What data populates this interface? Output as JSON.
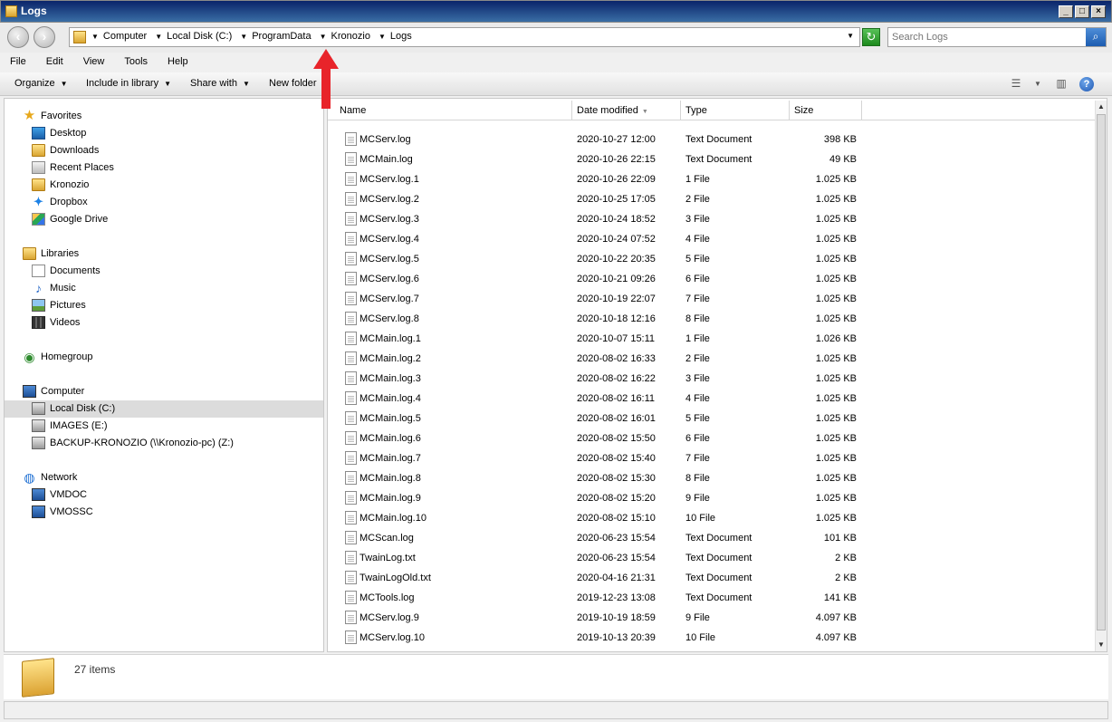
{
  "window": {
    "title": "Logs"
  },
  "address": {
    "crumbs": [
      "Computer",
      "Local Disk (C:)",
      "ProgramData",
      "Kronozio",
      "Logs"
    ]
  },
  "search": {
    "placeholder": "Search Logs"
  },
  "menu": [
    "File",
    "Edit",
    "View",
    "Tools",
    "Help"
  ],
  "toolbar": {
    "organize": "Organize",
    "include": "Include in library",
    "share": "Share with",
    "new_folder": "New folder"
  },
  "nav": {
    "favorites": "Favorites",
    "favorites_items": [
      "Desktop",
      "Downloads",
      "Recent Places",
      "Kronozio",
      "Dropbox",
      "Google Drive"
    ],
    "libraries": "Libraries",
    "libraries_items": [
      "Documents",
      "Music",
      "Pictures",
      "Videos"
    ],
    "homegroup": "Homegroup",
    "computer": "Computer",
    "computer_items": [
      "Local Disk (C:)",
      "IMAGES (E:)",
      "BACKUP-KRONOZIO (\\\\Kronozio-pc) (Z:)"
    ],
    "network": "Network",
    "network_items": [
      "VMDOC",
      "VMOSSC"
    ]
  },
  "columns": {
    "name": "Name",
    "date": "Date modified",
    "type": "Type",
    "size": "Size"
  },
  "files": [
    {
      "name": "MCServ.log",
      "date": "2020-10-27 12:00",
      "type": "Text Document",
      "size": "398 KB"
    },
    {
      "name": "MCMain.log",
      "date": "2020-10-26 22:15",
      "type": "Text Document",
      "size": "49 KB"
    },
    {
      "name": "MCServ.log.1",
      "date": "2020-10-26 22:09",
      "type": "1 File",
      "size": "1.025 KB"
    },
    {
      "name": "MCServ.log.2",
      "date": "2020-10-25 17:05",
      "type": "2 File",
      "size": "1.025 KB"
    },
    {
      "name": "MCServ.log.3",
      "date": "2020-10-24 18:52",
      "type": "3 File",
      "size": "1.025 KB"
    },
    {
      "name": "MCServ.log.4",
      "date": "2020-10-24 07:52",
      "type": "4 File",
      "size": "1.025 KB"
    },
    {
      "name": "MCServ.log.5",
      "date": "2020-10-22 20:35",
      "type": "5 File",
      "size": "1.025 KB"
    },
    {
      "name": "MCServ.log.6",
      "date": "2020-10-21 09:26",
      "type": "6 File",
      "size": "1.025 KB"
    },
    {
      "name": "MCServ.log.7",
      "date": "2020-10-19 22:07",
      "type": "7 File",
      "size": "1.025 KB"
    },
    {
      "name": "MCServ.log.8",
      "date": "2020-10-18 12:16",
      "type": "8 File",
      "size": "1.025 KB"
    },
    {
      "name": "MCMain.log.1",
      "date": "2020-10-07 15:11",
      "type": "1 File",
      "size": "1.026 KB"
    },
    {
      "name": "MCMain.log.2",
      "date": "2020-08-02 16:33",
      "type": "2 File",
      "size": "1.025 KB"
    },
    {
      "name": "MCMain.log.3",
      "date": "2020-08-02 16:22",
      "type": "3 File",
      "size": "1.025 KB"
    },
    {
      "name": "MCMain.log.4",
      "date": "2020-08-02 16:11",
      "type": "4 File",
      "size": "1.025 KB"
    },
    {
      "name": "MCMain.log.5",
      "date": "2020-08-02 16:01",
      "type": "5 File",
      "size": "1.025 KB"
    },
    {
      "name": "MCMain.log.6",
      "date": "2020-08-02 15:50",
      "type": "6 File",
      "size": "1.025 KB"
    },
    {
      "name": "MCMain.log.7",
      "date": "2020-08-02 15:40",
      "type": "7 File",
      "size": "1.025 KB"
    },
    {
      "name": "MCMain.log.8",
      "date": "2020-08-02 15:30",
      "type": "8 File",
      "size": "1.025 KB"
    },
    {
      "name": "MCMain.log.9",
      "date": "2020-08-02 15:20",
      "type": "9 File",
      "size": "1.025 KB"
    },
    {
      "name": "MCMain.log.10",
      "date": "2020-08-02 15:10",
      "type": "10 File",
      "size": "1.025 KB"
    },
    {
      "name": "MCScan.log",
      "date": "2020-06-23 15:54",
      "type": "Text Document",
      "size": "101 KB"
    },
    {
      "name": "TwainLog.txt",
      "date": "2020-06-23 15:54",
      "type": "Text Document",
      "size": "2 KB"
    },
    {
      "name": "TwainLogOld.txt",
      "date": "2020-04-16 21:31",
      "type": "Text Document",
      "size": "2 KB"
    },
    {
      "name": "MCTools.log",
      "date": "2019-12-23 13:08",
      "type": "Text Document",
      "size": "141 KB"
    },
    {
      "name": "MCServ.log.9",
      "date": "2019-10-19 18:59",
      "type": "9 File",
      "size": "4.097 KB"
    },
    {
      "name": "MCServ.log.10",
      "date": "2019-10-13 20:39",
      "type": "10 File",
      "size": "4.097 KB"
    }
  ],
  "details": {
    "count": "27 items"
  },
  "colors": {
    "annotation_arrow": "#e8242a",
    "selected_nav": "#dcdcdc"
  }
}
